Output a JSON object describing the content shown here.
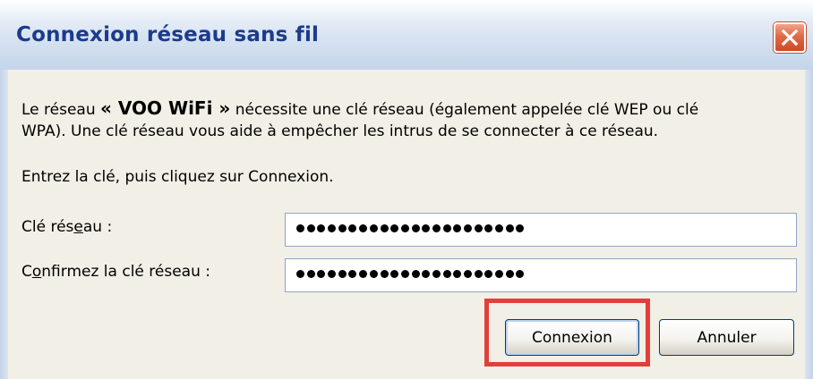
{
  "window": {
    "title": "Connexion réseau sans fil",
    "close_icon": "close-icon"
  },
  "message": {
    "line1_prefix": "Le réseau ",
    "network_name": "« VOO WiFi »",
    "line1_suffix": " nécessite une clé réseau (également appelée clé WEP ou clé",
    "line2": "WPA). Une clé réseau vous aide à empêcher les intrus de se connecter à ce réseau.",
    "instruction": "Entrez la clé, puis cliquez sur Connexion."
  },
  "fields": {
    "network_key": {
      "label_before": "Clé rés",
      "label_accel": "e",
      "label_after": "au :",
      "masked_char_count": 22
    },
    "confirm_key": {
      "label_before": "C",
      "label_accel": "o",
      "label_after": "nfirmez la clé réseau :",
      "masked_char_count": 22
    }
  },
  "buttons": {
    "connect_label": "Connexion",
    "cancel_label": "Annuler"
  },
  "annotation": {
    "highlight_color": "#e33f3a"
  },
  "colors": {
    "title_text": "#1b3c8c",
    "dialog_background": "#f1efe6",
    "close_button": "#e06a46"
  }
}
